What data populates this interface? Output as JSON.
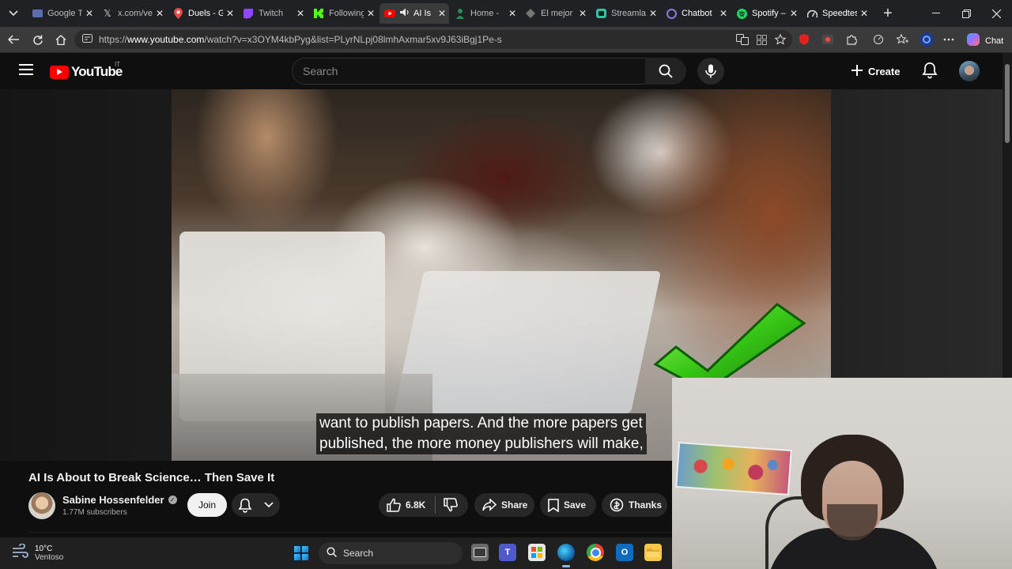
{
  "browser": {
    "tabs": [
      {
        "title": "Google T",
        "icon": "google-icon",
        "close": "✕"
      },
      {
        "title": "x.com/ve",
        "icon": "x-icon",
        "close": "✕"
      },
      {
        "title": "Duels - G",
        "icon": "map-pin-icon",
        "close": "✕"
      },
      {
        "title": "Twitch",
        "icon": "twitch-icon",
        "close": "✕"
      },
      {
        "title": "Following",
        "icon": "kick-icon",
        "close": "✕"
      },
      {
        "title": "AI Is",
        "icon": "youtube-icon",
        "close": "✕",
        "active": true
      },
      {
        "title": "Home -",
        "icon": "person-icon",
        "close": "✕"
      },
      {
        "title": "El mejor",
        "icon": "diamond-icon",
        "close": "✕"
      },
      {
        "title": "Streamla",
        "icon": "streamlabs-icon",
        "close": "✕"
      },
      {
        "title": "Chatbot",
        "icon": "chatbot-icon",
        "close": "✕"
      },
      {
        "title": "Spotify –",
        "icon": "spotify-icon",
        "close": "✕"
      },
      {
        "title": "Speedtes",
        "icon": "speedtest-icon",
        "close": "✕"
      }
    ],
    "new_tab": "+",
    "url_prefix": "https://",
    "url_domain": "www.youtube.com",
    "url_path": "/watch?v=x3OYM4kbPyg&list=PLyrNLpj08lmhAxmar5xv9J63iBgj1Pe-s",
    "chat_label": "Chat"
  },
  "youtube": {
    "logo_text": "YouTube",
    "logo_country": "IT",
    "search_placeholder": "Search",
    "create_label": "Create"
  },
  "video": {
    "subtitle_line1": "want to publish papers. And the more papers get",
    "subtitle_line2": "published, the more money publishers will make,",
    "title": "AI Is About to Break Science… Then Save It",
    "channel": "Sabine Hossenfelder",
    "verified_mark": "✓",
    "subscribers": "1.77M subscribers",
    "join_label": "Join",
    "likes": "6.8K",
    "share_label": "Share",
    "save_label": "Save",
    "thanks_label": "Thanks"
  },
  "taskbar": {
    "temperature": "10°C",
    "weather_desc": "Ventoso",
    "search_label": "Search"
  },
  "colors": {
    "youtube_red": "#ff0000",
    "background": "#0f0f0f",
    "accent_blue": "#0078d4"
  }
}
